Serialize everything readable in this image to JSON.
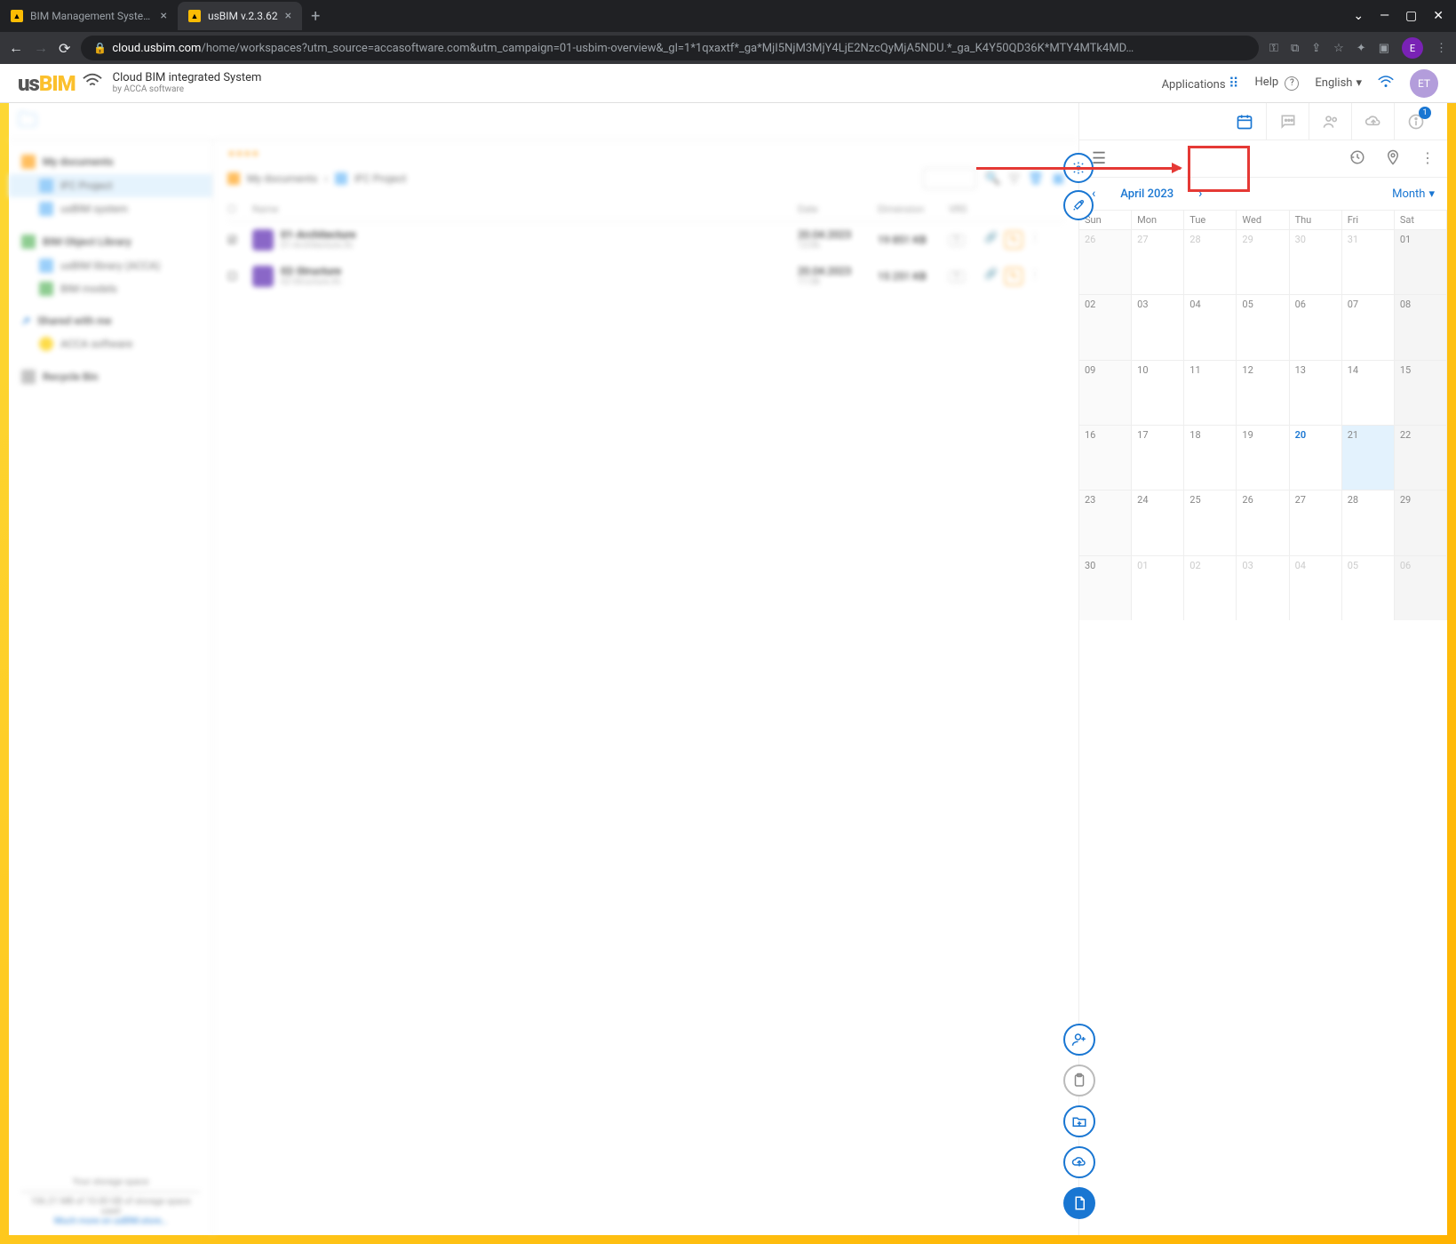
{
  "browser": {
    "tabs": [
      {
        "title": "BIM Management System | usBI…",
        "active": false
      },
      {
        "title": "usBIM v.2.3.62",
        "active": true
      }
    ],
    "url_host": "cloud.usbim.com",
    "url_path": "/home/workspaces?utm_source=accasoftware.com&utm_campaign=01-usbim-overview&_gl=1*1qxaxtf*_ga*MjI5NjM3MjY4LjE2NzcQyMjA5NDU.*_ga_K4Y50QD36K*MTY4MTk4MD…",
    "avatar": "E"
  },
  "header": {
    "logo_us": "us",
    "logo_bim": "BIM",
    "title": "Cloud BIM integrated System",
    "subtitle": "by ACCA software",
    "applications": "Applications",
    "help": "Help",
    "language": "English",
    "user_initials": "ET"
  },
  "sidebar": {
    "my_documents": "My documents",
    "items1": [
      "IFC Project",
      "usBIM system"
    ],
    "bim_library": "BIM Object Library",
    "items2": [
      "usBIM library (ACCA)",
      "BIM models"
    ],
    "shared": "Shared with me",
    "items3": [
      "ACCA software"
    ],
    "recycle": "Recycle Bin",
    "storage_title": "Your storage space",
    "storage_detail": "106.21 MB of 10.00 GB of storage space used",
    "storage_link": "Much more on usBIM.store…"
  },
  "main": {
    "crumb1": "My documents",
    "crumb2": "IFC Project",
    "cols": {
      "name": "Name",
      "date": "Date",
      "dim": "Dimension",
      "vrs": "VRS"
    },
    "rows": [
      {
        "name": "01-Architecture",
        "sub": "01-Architecture.ifc",
        "date": "20.04.2023",
        "time": "12:06",
        "dim": "19 851 KB",
        "vrs": "1"
      },
      {
        "name": "02-Structure",
        "sub": "02-Structure.ifc",
        "date": "20.04.2023",
        "time": "11:58",
        "dim": "15 251 KB",
        "vrs": "1"
      }
    ]
  },
  "right_strip": {
    "info_badge": "1"
  },
  "calendar": {
    "month_label": "April 2023",
    "view_label": "Month",
    "dow": [
      "Sun",
      "Mon",
      "Tue",
      "Wed",
      "Thu",
      "Fri",
      "Sat"
    ],
    "days": [
      [
        {
          "n": "26",
          "other": true,
          "sun": true
        },
        {
          "n": "27",
          "other": true
        },
        {
          "n": "28",
          "other": true
        },
        {
          "n": "29",
          "other": true
        },
        {
          "n": "30",
          "other": true
        },
        {
          "n": "31",
          "other": true
        },
        {
          "n": "01",
          "sat": true
        }
      ],
      [
        {
          "n": "02",
          "sun": true
        },
        {
          "n": "03"
        },
        {
          "n": "04"
        },
        {
          "n": "05"
        },
        {
          "n": "06"
        },
        {
          "n": "07"
        },
        {
          "n": "08",
          "sat": true
        }
      ],
      [
        {
          "n": "09",
          "sun": true
        },
        {
          "n": "10"
        },
        {
          "n": "11"
        },
        {
          "n": "12"
        },
        {
          "n": "13"
        },
        {
          "n": "14"
        },
        {
          "n": "15",
          "sat": true
        }
      ],
      [
        {
          "n": "16",
          "sun": true
        },
        {
          "n": "17"
        },
        {
          "n": "18"
        },
        {
          "n": "19"
        },
        {
          "n": "20",
          "today": true
        },
        {
          "n": "21",
          "sel": true
        },
        {
          "n": "22",
          "sat": true
        }
      ],
      [
        {
          "n": "23",
          "sun": true
        },
        {
          "n": "24"
        },
        {
          "n": "25"
        },
        {
          "n": "26"
        },
        {
          "n": "27"
        },
        {
          "n": "28"
        },
        {
          "n": "29",
          "sat": true
        }
      ],
      [
        {
          "n": "30",
          "sun": true
        },
        {
          "n": "01",
          "other": true
        },
        {
          "n": "02",
          "other": true
        },
        {
          "n": "03",
          "other": true
        },
        {
          "n": "04",
          "other": true
        },
        {
          "n": "05",
          "other": true
        },
        {
          "n": "06",
          "other": true,
          "sat": true
        }
      ]
    ]
  }
}
